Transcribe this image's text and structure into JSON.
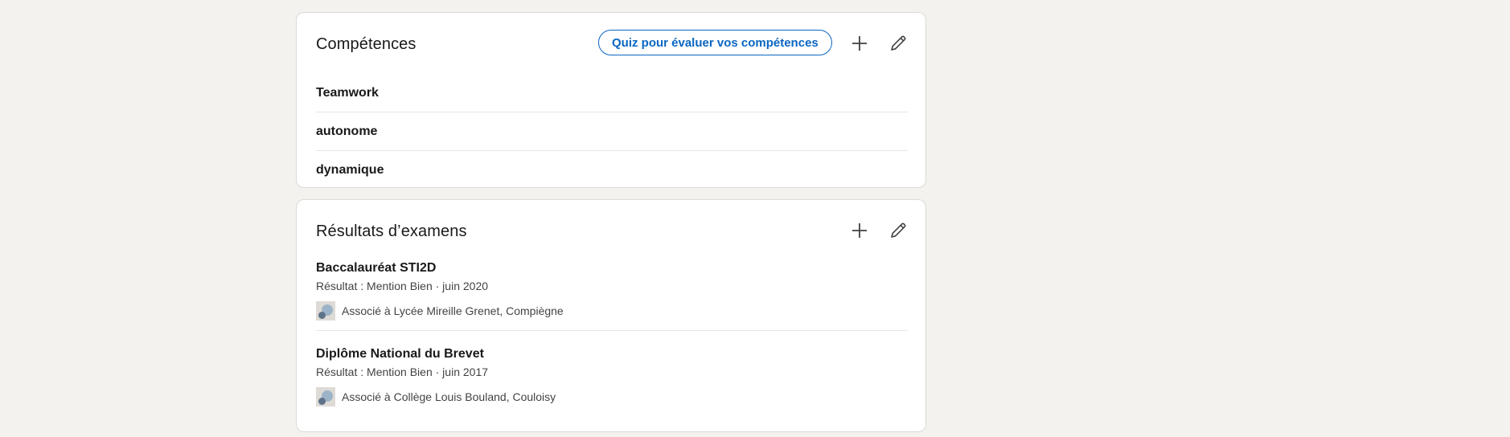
{
  "skills": {
    "title": "Compétences",
    "quiz_label": "Quiz pour évaluer vos compétences",
    "add_icon": "plus-icon",
    "edit_icon": "pencil-icon",
    "items": [
      {
        "label": "Teamwork"
      },
      {
        "label": "autonome"
      },
      {
        "label": "dynamique"
      }
    ]
  },
  "tests": {
    "title": "Résultats d’examens",
    "add_icon": "plus-icon",
    "edit_icon": "pencil-icon",
    "items": [
      {
        "name": "Baccalauréat STI2D",
        "meta": "Résultat : Mention Bien · juin 2020",
        "association": "Associé à Lycée Mireille Grenet, Compiègne"
      },
      {
        "name": "Diplôme National du Brevet",
        "meta": "Résultat : Mention Bien · juin 2017",
        "association": "Associé à Collège Louis Bouland, Couloisy"
      }
    ]
  },
  "colors": {
    "page_background": "#f3f2ef",
    "card_background": "#ffffff",
    "accent": "#0a66c2",
    "icon": "#404040"
  }
}
